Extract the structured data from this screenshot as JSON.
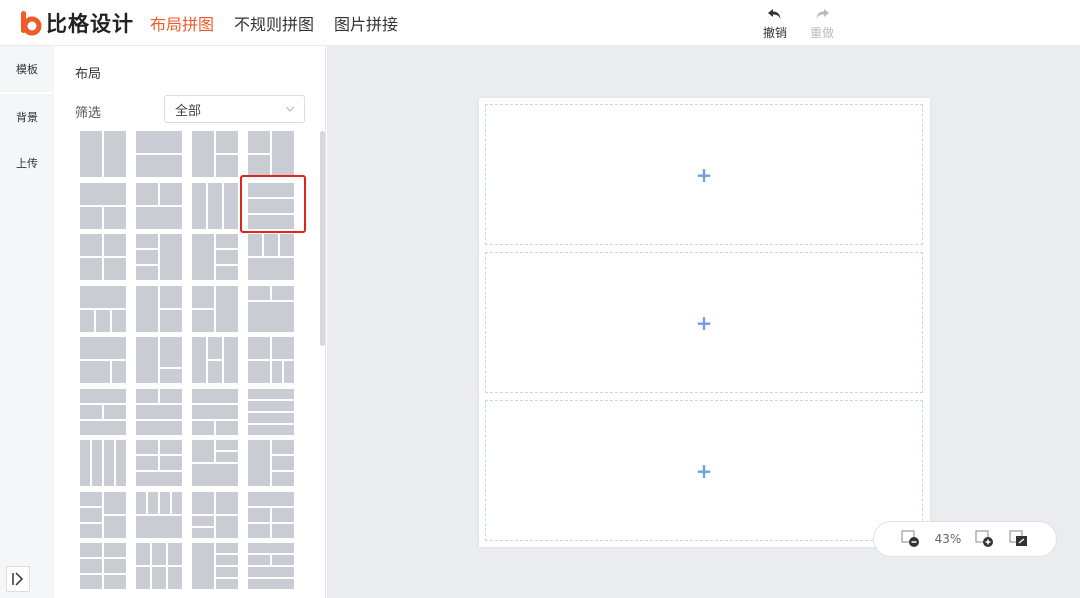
{
  "header": {
    "logo_text": "比格设计",
    "nav": [
      "布局拼图",
      "不规则拼图",
      "图片拼接"
    ],
    "undo_label": "撤销",
    "redo_label": "重做"
  },
  "rail": {
    "tabs": [
      "模板",
      "背景",
      "上传"
    ]
  },
  "panel": {
    "title": "布局",
    "filter_label": "筛选",
    "filter_value": "全部"
  },
  "canvas": {
    "zoom": "43%",
    "slot_symbol": "+"
  },
  "colors": {
    "accent": "#f05a28",
    "selection": "#e0261b",
    "tile": "#c9ccd3",
    "slot_border": "#c5d6f2"
  }
}
